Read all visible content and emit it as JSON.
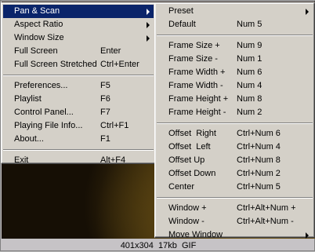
{
  "main_menu": {
    "items": [
      {
        "label": "Pan & Scan",
        "key": "",
        "submenu": true,
        "highlighted": true
      },
      {
        "label": "Aspect Ratio",
        "key": "",
        "submenu": true
      },
      {
        "label": "Window Size",
        "key": "",
        "submenu": true
      },
      {
        "label": "Full Screen",
        "key": "Enter"
      },
      {
        "label": "Full Screen Stretched",
        "key": "Ctrl+Enter"
      },
      {
        "label": "Preferences...",
        "key": "F5"
      },
      {
        "label": "Playlist",
        "key": "F6"
      },
      {
        "label": "Control Panel...",
        "key": "F7"
      },
      {
        "label": "Playing File Info...",
        "key": "Ctrl+F1"
      },
      {
        "label": "About...",
        "key": "F1"
      },
      {
        "label": "Exit",
        "key": "Alt+F4"
      }
    ]
  },
  "sub_menu": {
    "items": [
      {
        "label": "Preset",
        "key": "",
        "submenu": true
      },
      {
        "label": "Default",
        "key": "Num 5"
      },
      {
        "label": "Frame Size +",
        "key": "Num 9"
      },
      {
        "label": "Frame Size -",
        "key": "Num 1"
      },
      {
        "label": "Frame Width +",
        "key": "Num 6"
      },
      {
        "label": "Frame Width -",
        "key": "Num 4"
      },
      {
        "label": "Frame Height +",
        "key": "Num 8"
      },
      {
        "label": "Frame Height -",
        "key": "Num 2"
      },
      {
        "label": "Offset  Right",
        "key": "Ctrl+Num 6"
      },
      {
        "label": "Offset  Left",
        "key": "Ctrl+Num 4"
      },
      {
        "label": "Offset Up",
        "key": "Ctrl+Num 8"
      },
      {
        "label": "Offset Down",
        "key": "Ctrl+Num 2"
      },
      {
        "label": "Center",
        "key": "Ctrl+Num 5"
      },
      {
        "label": "Window +",
        "key": "Ctrl+Alt+Num +"
      },
      {
        "label": "Window -",
        "key": "Ctrl+Alt+Num -"
      },
      {
        "label": "Move Window",
        "key": "",
        "submenu": true
      }
    ]
  },
  "caption": "401x304  17kb  GIF",
  "colors": {
    "highlight": "#0a246a",
    "menu_bg": "#d4d0c8",
    "caption_bg": "#c6c3c6"
  }
}
